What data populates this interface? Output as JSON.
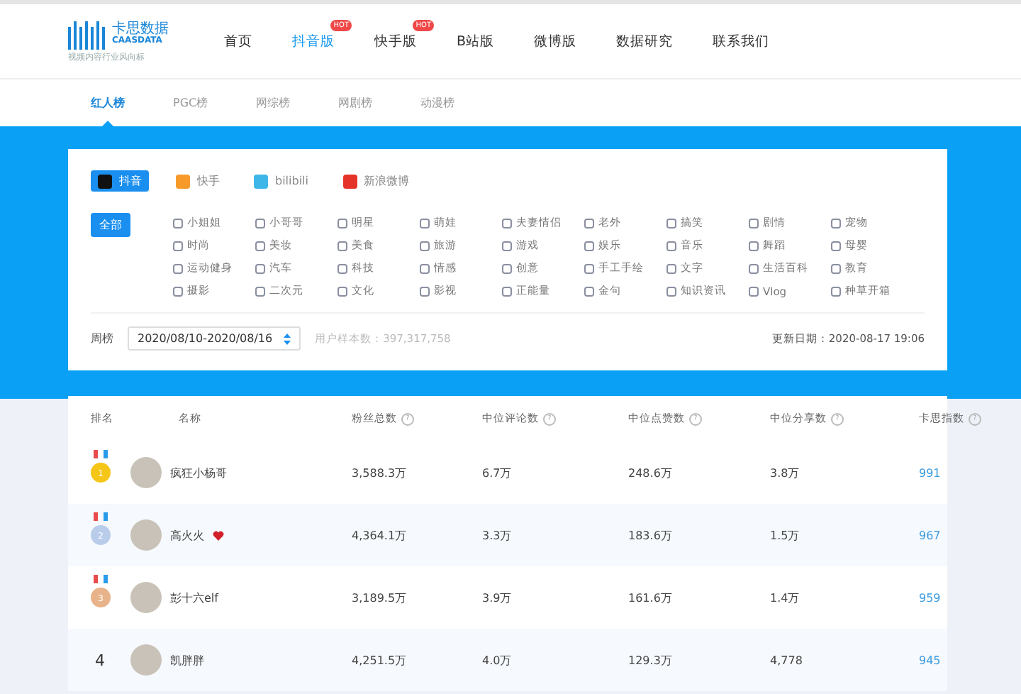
{
  "logo": {
    "name": "卡思数据",
    "latin": "CAASDATA",
    "slogan": "视频内容行业风向标"
  },
  "nav": [
    {
      "label": "首页",
      "selected": false
    },
    {
      "label": "抖音版",
      "selected": true,
      "badge": "HOT"
    },
    {
      "label": "快手版",
      "selected": false,
      "badge": "HOT"
    },
    {
      "label": "B站版",
      "selected": false
    },
    {
      "label": "微博版",
      "selected": false
    },
    {
      "label": "数据研究",
      "selected": false
    },
    {
      "label": "联系我们",
      "selected": false
    }
  ],
  "subnav": [
    {
      "label": "红人榜",
      "selected": true
    },
    {
      "label": "PGC榜",
      "selected": false
    },
    {
      "label": "网综榜",
      "selected": false
    },
    {
      "label": "网剧榜",
      "selected": false
    },
    {
      "label": "动漫榜",
      "selected": false
    }
  ],
  "platforms": [
    {
      "label": "抖音",
      "kind": "douyin",
      "selected": true
    },
    {
      "label": "快手",
      "kind": "kuaishou",
      "selected": false
    },
    {
      "label": "bilibili",
      "kind": "bilibili",
      "selected": false
    },
    {
      "label": "新浪微博",
      "kind": "weibo",
      "selected": false
    }
  ],
  "all_button": {
    "label": "全部",
    "selected": true
  },
  "categories": [
    "小姐姐",
    "小哥哥",
    "明星",
    "萌娃",
    "夫妻情侣",
    "老外",
    "搞笑",
    "剧情",
    "宠物",
    "时尚",
    "美妆",
    "美食",
    "旅游",
    "游戏",
    "娱乐",
    "音乐",
    "舞蹈",
    "母婴",
    "运动健身",
    "汽车",
    "科技",
    "情感",
    "创意",
    "手工手绘",
    "文字",
    "生活百科",
    "教育",
    "摄影",
    "二次元",
    "文化",
    "影视",
    "正能量",
    "金句",
    "知识资讯",
    "Vlog",
    "种草开箱"
  ],
  "period": {
    "label": "周榜",
    "value": "2020/08/10-2020/08/16",
    "sample": "用户样本数：397,317,758",
    "updated": "更新日期：2020-08-17 19:06"
  },
  "table": {
    "columns": [
      {
        "label": "排名"
      },
      {
        "label": "名称"
      },
      {
        "label": "粉丝总数",
        "help": "?"
      },
      {
        "label": "中位评论数",
        "help": "?"
      },
      {
        "label": "中位点赞数",
        "help": "?"
      },
      {
        "label": "中位分享数",
        "help": "?"
      },
      {
        "label": "卡思指数",
        "help": "?"
      }
    ],
    "rows": [
      {
        "rank": "1",
        "kind": "medal",
        "color": "#f5c518",
        "name": "疯狂小杨哥",
        "heart": false,
        "fans": "3,588.3万",
        "comments": "6.7万",
        "likes": "248.6万",
        "shares": "3.8万",
        "index": "991"
      },
      {
        "rank": "2",
        "kind": "medal",
        "color": "#b9cdeb",
        "name": "高火火",
        "heart": true,
        "fans": "4,364.1万",
        "comments": "3.3万",
        "likes": "183.6万",
        "shares": "1.5万",
        "index": "967"
      },
      {
        "rank": "3",
        "kind": "medal",
        "color": "#e8b38a",
        "name": "彭十六elf",
        "heart": false,
        "fans": "3,189.5万",
        "comments": "3.9万",
        "likes": "161.6万",
        "shares": "1.4万",
        "index": "959"
      },
      {
        "rank": "4",
        "kind": "plain",
        "color": "#333333",
        "name": "凯胖胖",
        "heart": false,
        "fans": "4,251.5万",
        "comments": "4.0万",
        "likes": "129.3万",
        "shares": "4,778",
        "index": "945"
      }
    ]
  }
}
